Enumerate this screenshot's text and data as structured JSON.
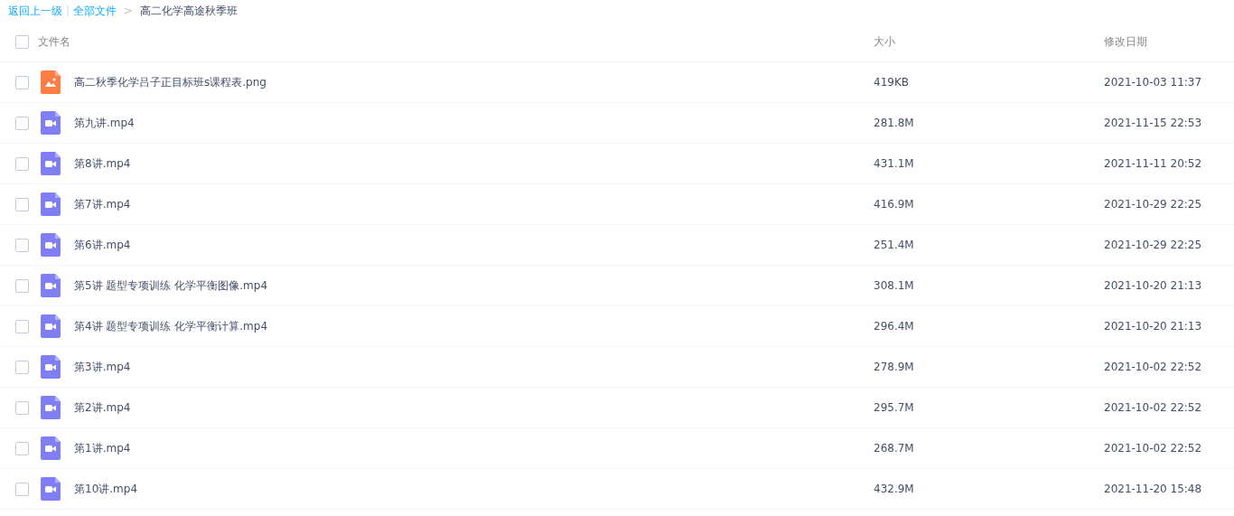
{
  "breadcrumb": {
    "back": "返回上一级",
    "separator": "|",
    "root": "全部文件",
    "arrow": ">",
    "current": "高二化学高途秋季班"
  },
  "table": {
    "select_all": {
      "checked": false
    },
    "columns": [
      "文件名",
      "大小",
      "修改日期"
    ],
    "rows": [
      {
        "kind": "image",
        "name": "高二秋季化学吕子正目标班s课程表.png",
        "size": "419KB",
        "date": "2021-10-03 11:37",
        "checked": false
      },
      {
        "kind": "video",
        "name": "第九讲.mp4",
        "size": "281.8M",
        "date": "2021-11-15 22:53",
        "checked": false
      },
      {
        "kind": "video",
        "name": "第8讲.mp4",
        "size": "431.1M",
        "date": "2021-11-11 20:52",
        "checked": false
      },
      {
        "kind": "video",
        "name": "第7讲.mp4",
        "size": "416.9M",
        "date": "2021-10-29 22:25",
        "checked": false
      },
      {
        "kind": "video",
        "name": "第6讲.mp4",
        "size": "251.4M",
        "date": "2021-10-29 22:25",
        "checked": false
      },
      {
        "kind": "video",
        "name": "第5讲 题型专项训练 化学平衡图像.mp4",
        "size": "308.1M",
        "date": "2021-10-20 21:13",
        "checked": false
      },
      {
        "kind": "video",
        "name": "第4讲 题型专项训练 化学平衡计算.mp4",
        "size": "296.4M",
        "date": "2021-10-20 21:13",
        "checked": false
      },
      {
        "kind": "video",
        "name": "第3讲.mp4",
        "size": "278.9M",
        "date": "2021-10-02 22:52",
        "checked": false
      },
      {
        "kind": "video",
        "name": "第2讲.mp4",
        "size": "295.7M",
        "date": "2021-10-02 22:52",
        "checked": false
      },
      {
        "kind": "video",
        "name": "第1讲.mp4",
        "size": "268.7M",
        "date": "2021-10-02 22:52",
        "checked": false
      },
      {
        "kind": "video",
        "name": "第10讲.mp4",
        "size": "432.9M",
        "date": "2021-11-20 15:48",
        "checked": false
      }
    ]
  }
}
